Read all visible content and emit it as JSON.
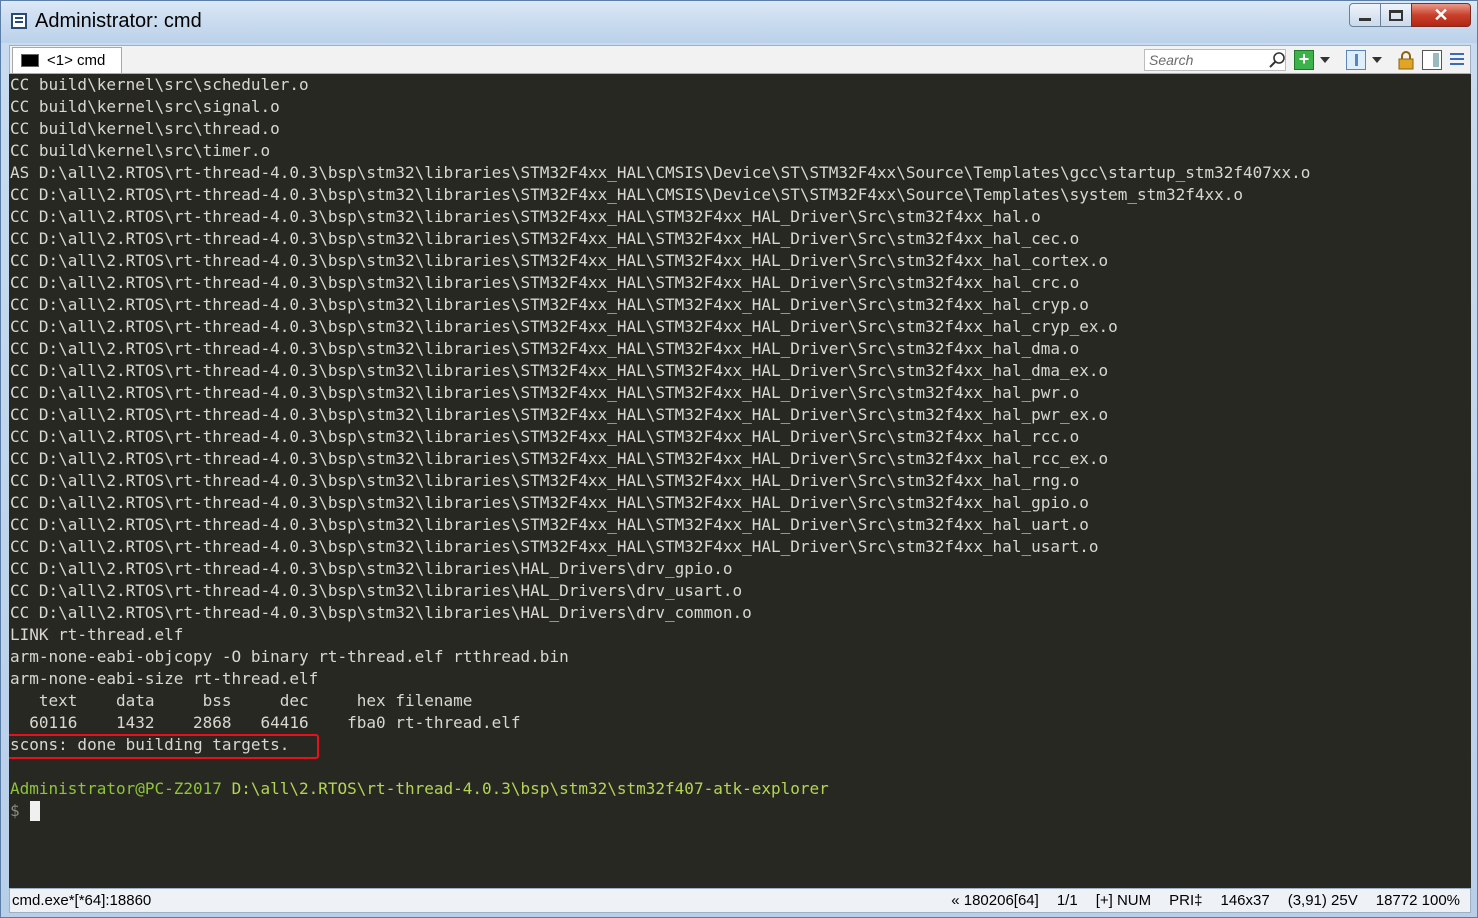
{
  "window": {
    "title": "Administrator: cmd"
  },
  "tabbar": {
    "tab_label": "<1> cmd",
    "search_placeholder": "Search"
  },
  "console": {
    "lines": [
      "CC build\\kernel\\src\\scheduler.o",
      "CC build\\kernel\\src\\signal.o",
      "CC build\\kernel\\src\\thread.o",
      "CC build\\kernel\\src\\timer.o",
      "AS D:\\all\\2.RTOS\\rt-thread-4.0.3\\bsp\\stm32\\libraries\\STM32F4xx_HAL\\CMSIS\\Device\\ST\\STM32F4xx\\Source\\Templates\\gcc\\startup_stm32f407xx.o",
      "CC D:\\all\\2.RTOS\\rt-thread-4.0.3\\bsp\\stm32\\libraries\\STM32F4xx_HAL\\CMSIS\\Device\\ST\\STM32F4xx\\Source\\Templates\\system_stm32f4xx.o",
      "CC D:\\all\\2.RTOS\\rt-thread-4.0.3\\bsp\\stm32\\libraries\\STM32F4xx_HAL\\STM32F4xx_HAL_Driver\\Src\\stm32f4xx_hal.o",
      "CC D:\\all\\2.RTOS\\rt-thread-4.0.3\\bsp\\stm32\\libraries\\STM32F4xx_HAL\\STM32F4xx_HAL_Driver\\Src\\stm32f4xx_hal_cec.o",
      "CC D:\\all\\2.RTOS\\rt-thread-4.0.3\\bsp\\stm32\\libraries\\STM32F4xx_HAL\\STM32F4xx_HAL_Driver\\Src\\stm32f4xx_hal_cortex.o",
      "CC D:\\all\\2.RTOS\\rt-thread-4.0.3\\bsp\\stm32\\libraries\\STM32F4xx_HAL\\STM32F4xx_HAL_Driver\\Src\\stm32f4xx_hal_crc.o",
      "CC D:\\all\\2.RTOS\\rt-thread-4.0.3\\bsp\\stm32\\libraries\\STM32F4xx_HAL\\STM32F4xx_HAL_Driver\\Src\\stm32f4xx_hal_cryp.o",
      "CC D:\\all\\2.RTOS\\rt-thread-4.0.3\\bsp\\stm32\\libraries\\STM32F4xx_HAL\\STM32F4xx_HAL_Driver\\Src\\stm32f4xx_hal_cryp_ex.o",
      "CC D:\\all\\2.RTOS\\rt-thread-4.0.3\\bsp\\stm32\\libraries\\STM32F4xx_HAL\\STM32F4xx_HAL_Driver\\Src\\stm32f4xx_hal_dma.o",
      "CC D:\\all\\2.RTOS\\rt-thread-4.0.3\\bsp\\stm32\\libraries\\STM32F4xx_HAL\\STM32F4xx_HAL_Driver\\Src\\stm32f4xx_hal_dma_ex.o",
      "CC D:\\all\\2.RTOS\\rt-thread-4.0.3\\bsp\\stm32\\libraries\\STM32F4xx_HAL\\STM32F4xx_HAL_Driver\\Src\\stm32f4xx_hal_pwr.o",
      "CC D:\\all\\2.RTOS\\rt-thread-4.0.3\\bsp\\stm32\\libraries\\STM32F4xx_HAL\\STM32F4xx_HAL_Driver\\Src\\stm32f4xx_hal_pwr_ex.o",
      "CC D:\\all\\2.RTOS\\rt-thread-4.0.3\\bsp\\stm32\\libraries\\STM32F4xx_HAL\\STM32F4xx_HAL_Driver\\Src\\stm32f4xx_hal_rcc.o",
      "CC D:\\all\\2.RTOS\\rt-thread-4.0.3\\bsp\\stm32\\libraries\\STM32F4xx_HAL\\STM32F4xx_HAL_Driver\\Src\\stm32f4xx_hal_rcc_ex.o",
      "CC D:\\all\\2.RTOS\\rt-thread-4.0.3\\bsp\\stm32\\libraries\\STM32F4xx_HAL\\STM32F4xx_HAL_Driver\\Src\\stm32f4xx_hal_rng.o",
      "CC D:\\all\\2.RTOS\\rt-thread-4.0.3\\bsp\\stm32\\libraries\\STM32F4xx_HAL\\STM32F4xx_HAL_Driver\\Src\\stm32f4xx_hal_gpio.o",
      "CC D:\\all\\2.RTOS\\rt-thread-4.0.3\\bsp\\stm32\\libraries\\STM32F4xx_HAL\\STM32F4xx_HAL_Driver\\Src\\stm32f4xx_hal_uart.o",
      "CC D:\\all\\2.RTOS\\rt-thread-4.0.3\\bsp\\stm32\\libraries\\STM32F4xx_HAL\\STM32F4xx_HAL_Driver\\Src\\stm32f4xx_hal_usart.o",
      "CC D:\\all\\2.RTOS\\rt-thread-4.0.3\\bsp\\stm32\\libraries\\HAL_Drivers\\drv_gpio.o",
      "CC D:\\all\\2.RTOS\\rt-thread-4.0.3\\bsp\\stm32\\libraries\\HAL_Drivers\\drv_usart.o",
      "CC D:\\all\\2.RTOS\\rt-thread-4.0.3\\bsp\\stm32\\libraries\\HAL_Drivers\\drv_common.o",
      "LINK rt-thread.elf",
      "arm-none-eabi-objcopy -O binary rt-thread.elf rtthread.bin",
      "arm-none-eabi-size rt-thread.elf",
      "   text    data     bss     dec     hex filename",
      "  60116    1432    2868   64416    fba0 rt-thread.elf",
      "scons: done building targets."
    ],
    "prompt_user": "Administrator@PC-Z2017",
    "prompt_path": "D:\\all\\2.RTOS\\rt-thread-4.0.3\\bsp\\stm32\\stm32f407-atk-explorer",
    "prompt_symbol": "$"
  },
  "statusbar": {
    "left": "cmd.exe*[*64]:18860",
    "items": [
      "« 180206[64]",
      "1/1",
      "[+] NUM",
      "PRI‡",
      "146x37",
      "(3,91) 25V",
      "18772 100%"
    ]
  },
  "colors": {
    "console_bg": "#272822",
    "console_fg": "#d8d8d0",
    "prompt_green": "#8fc43a",
    "highlight_red": "#e8101a"
  }
}
